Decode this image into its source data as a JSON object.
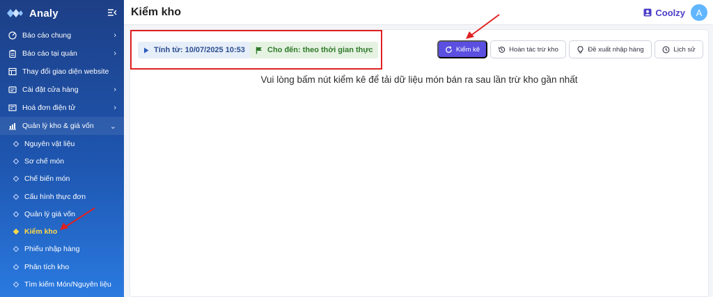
{
  "sidebar": {
    "brand": "Analy",
    "menu": [
      {
        "label": "Báo cáo chung",
        "icon": "dashboard-icon",
        "chevron": "›"
      },
      {
        "label": "Báo cáo tại quán",
        "icon": "clipboard-icon",
        "chevron": "›"
      },
      {
        "label": "Thay đổi giao diện website",
        "icon": "layout-icon",
        "chevron": ""
      },
      {
        "label": "Cài đặt cửa hàng",
        "icon": "store-settings-icon",
        "chevron": "›"
      },
      {
        "label": "Hoá đơn điện tử",
        "icon": "invoice-icon",
        "chevron": "›"
      },
      {
        "label": "Quản lý kho & giá vốn",
        "icon": "warehouse-chart-icon",
        "chevron": "⌄"
      }
    ],
    "submenu": [
      {
        "label": "Nguyên vật liệu"
      },
      {
        "label": "Sơ chế món"
      },
      {
        "label": "Chế biến món"
      },
      {
        "label": "Cấu hình thực đơn"
      },
      {
        "label": "Quản lý giá vốn"
      },
      {
        "label": "Kiểm kho",
        "active": true
      },
      {
        "label": "Phiếu nhập hàng"
      },
      {
        "label": "Phân tích kho"
      },
      {
        "label": "Tìm kiếm Món/Nguyên liệu"
      }
    ]
  },
  "header": {
    "title": "Kiểm kho",
    "user_name": "Coolzy",
    "avatar_letter": "A"
  },
  "filters": {
    "from_label": "Tính từ: 10/07/2025 10:53",
    "to_label": "Cho đến: theo thời gian thực"
  },
  "actions": {
    "stocktake": "Kiểm kê",
    "undo": "Hoàn tác trừ kho",
    "suggest": "Đề xuất nhập hàng",
    "history": "Lịch sử"
  },
  "message": "Vui lòng bấm nút kiểm kê để tải dữ liệu món bán ra sau lần trừ kho gần nhất",
  "colors": {
    "primary": "#5a4fe0",
    "highlight_red": "#e02020",
    "active_menu": "#ffd84a"
  }
}
